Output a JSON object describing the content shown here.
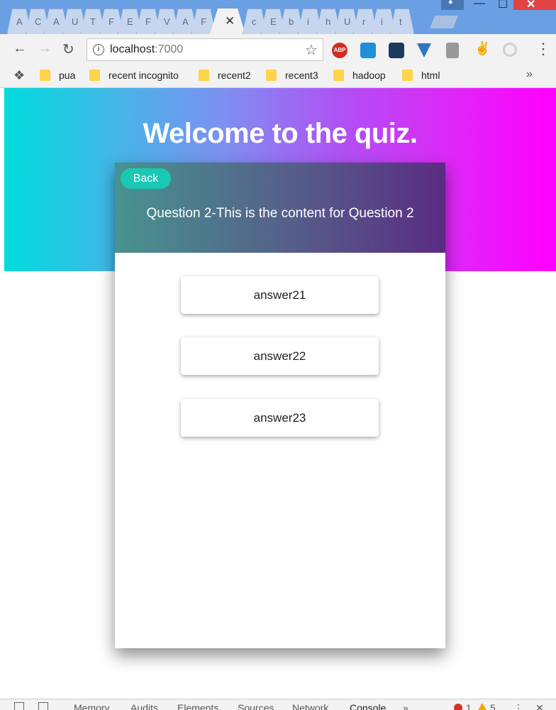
{
  "browser": {
    "tabs": [
      "A",
      "C",
      "A",
      "U",
      "T",
      "F",
      "E",
      "F",
      "V",
      "A",
      "F",
      "",
      "c",
      "E",
      "b",
      "i",
      "h",
      "U",
      "r",
      "i",
      "t"
    ],
    "active_tab_index": 11,
    "close_tab_glyph": "✕",
    "url_host": "localhost",
    "url_port": ":7000",
    "bookmarks": [
      "pua",
      "recent incognito",
      "recent2",
      "recent3",
      "hadoop",
      "html"
    ],
    "abp_label": "ABP"
  },
  "page": {
    "title": "Welcome to the quiz.",
    "back_label": "Back",
    "question": "Question 2-This is the content for Question 2",
    "answers": [
      "answer21",
      "answer22",
      "answer23"
    ]
  },
  "devtools": {
    "tabs": [
      "Memory",
      "Audits",
      "Elements",
      "Sources",
      "Network",
      "Console"
    ],
    "errors": "1",
    "warnings": "5"
  }
}
